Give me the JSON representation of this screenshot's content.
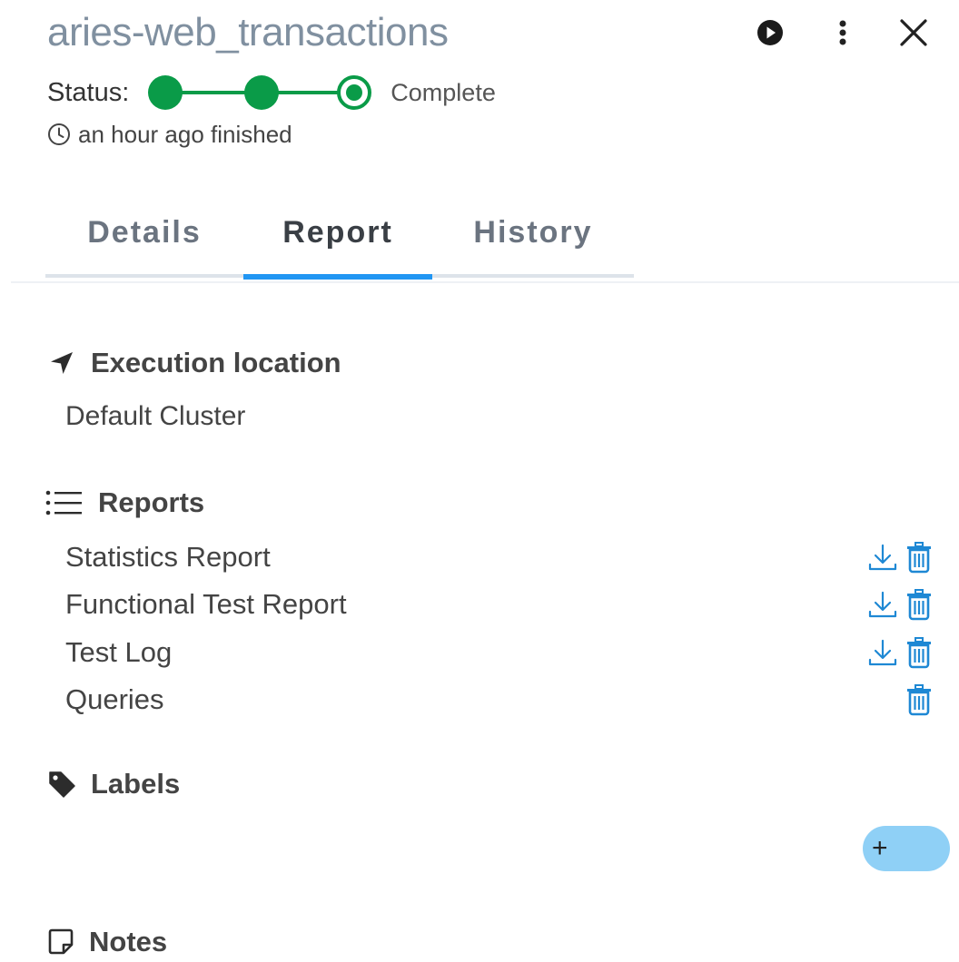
{
  "header": {
    "title": "aries-web_transactions",
    "run_icon": "play-circle-icon",
    "more_icon": "more-vertical-icon",
    "close_icon": "close-icon"
  },
  "status": {
    "label": "Status:",
    "text": "Complete",
    "steps_completed": 3,
    "steps_total": 3,
    "color": "#0a9b48"
  },
  "time": {
    "icon": "clock-icon",
    "text": "an hour ago finished"
  },
  "tabs": [
    {
      "label": "Details",
      "active": false
    },
    {
      "label": "Report",
      "active": true
    },
    {
      "label": "History",
      "active": false
    }
  ],
  "execution_location": {
    "icon": "location-arrow-icon",
    "title": "Execution location",
    "value": "Default Cluster"
  },
  "reports": {
    "icon": "list-icon",
    "title": "Reports",
    "items": [
      {
        "name": "Statistics Report",
        "download": true,
        "delete": true
      },
      {
        "name": "Functional Test Report",
        "download": true,
        "delete": true
      },
      {
        "name": "Test Log",
        "download": true,
        "delete": true
      },
      {
        "name": "Queries",
        "download": false,
        "delete": true
      }
    ]
  },
  "labels": {
    "icon": "tag-icon",
    "title": "Labels",
    "add_label": "+"
  },
  "notes": {
    "icon": "note-icon",
    "title": "Notes"
  },
  "colors": {
    "accent": "#2196f3",
    "action_icon": "#1e88d4",
    "title": "#8090a0",
    "add_button": "#8fd0f6"
  }
}
